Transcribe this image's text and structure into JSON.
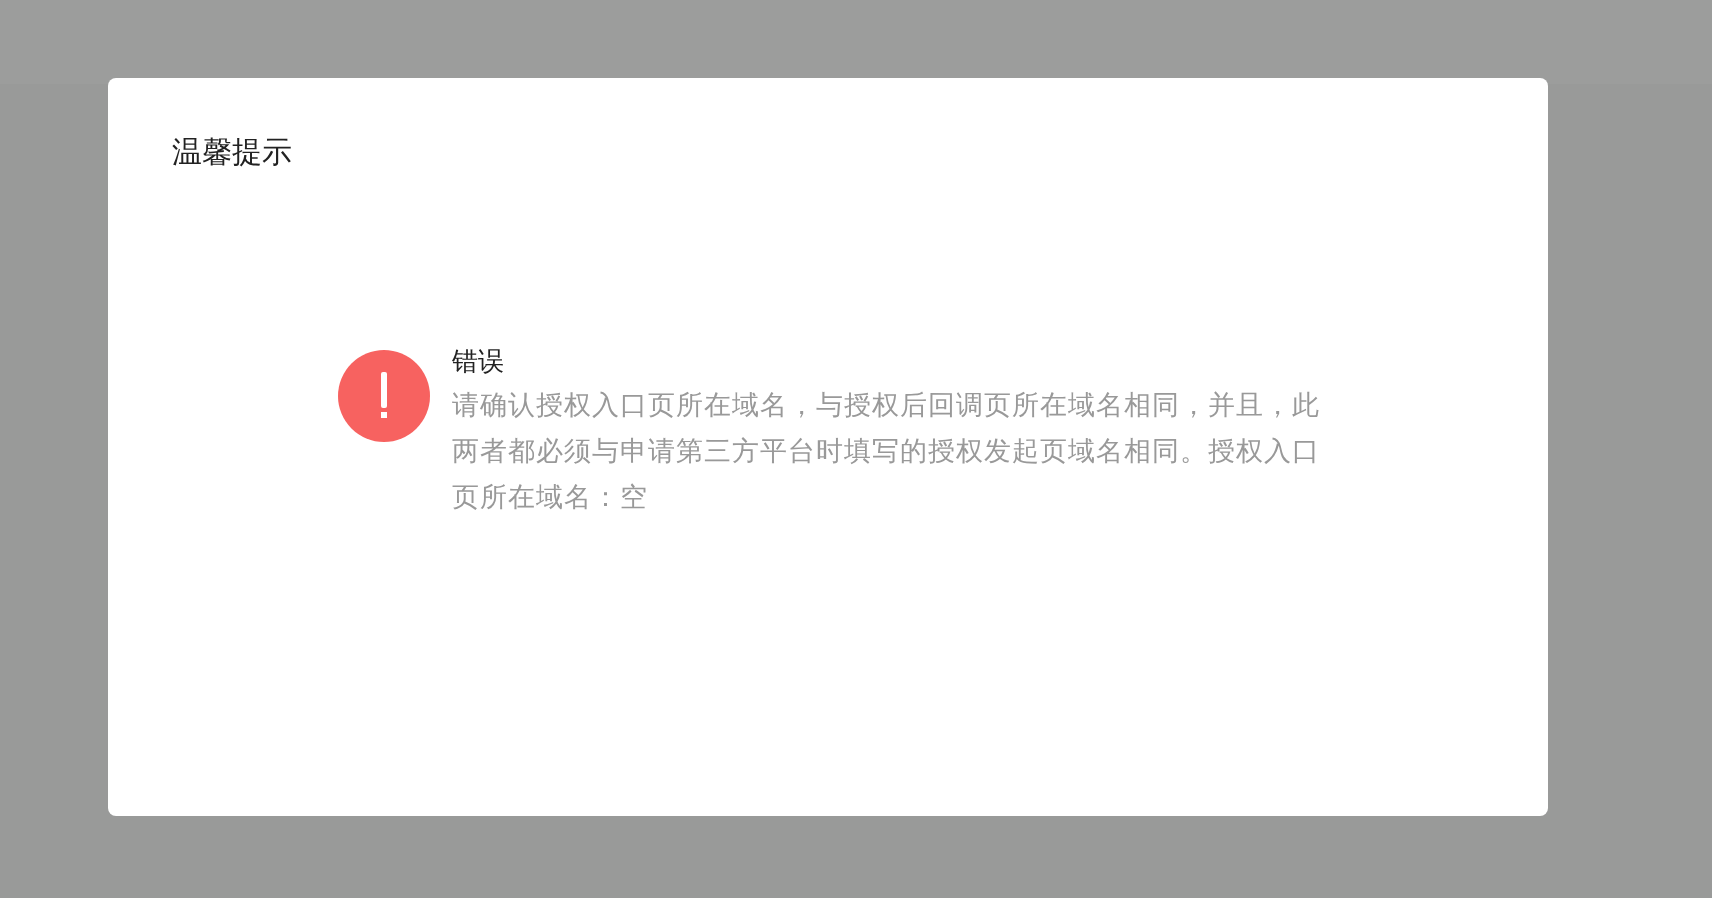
{
  "dialog": {
    "title": "温馨提示",
    "alert": {
      "kind": "error",
      "heading": "错误",
      "message": "请确认授权入口页所在域名，与授权后回调页所在域名相同，并且，此两者都必须与申请第三方平台时填写的授权发起页域名相同。授权入口页所在域名：空"
    }
  }
}
